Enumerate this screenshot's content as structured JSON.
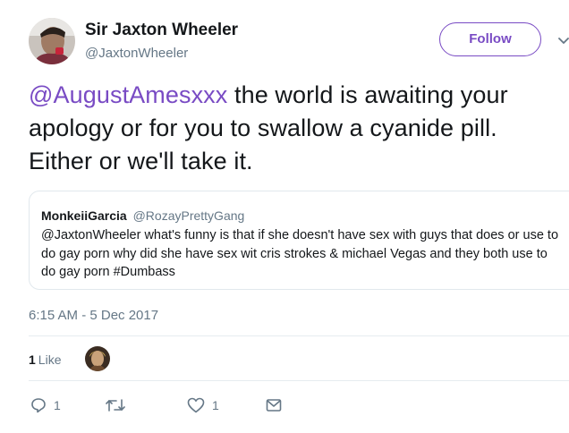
{
  "author": {
    "display_name": "Sir Jaxton Wheeler",
    "handle": "@JaxtonWheeler"
  },
  "follow_button": {
    "label": "Follow"
  },
  "tweet": {
    "mention": "@AugustAmesxxx",
    "text": " the world is awaiting your apology or for you to swallow a cyanide pill. Either or we'll take it."
  },
  "quoted_tweet": {
    "display_name": "MonkeiiGarcia",
    "handle": "@RozayPrettyGang",
    "text": "@JaxtonWheeler what's funny is that if she doesn't have sex with guys that does or use to do gay porn why did she have sex wit cris strokes & michael Vegas and they both use to do gay porn #Dumbass"
  },
  "timestamp": "6:15 AM - 5 Dec 2017",
  "likes": {
    "count": "1",
    "label": "Like"
  },
  "actions": {
    "reply_count": "1",
    "retweet_count": "",
    "like_count": "1"
  },
  "icons": {
    "reply": "reply-icon",
    "retweet": "retweet-icon",
    "like": "heart-icon",
    "dm": "envelope-icon",
    "caret": "chevron-down-icon"
  },
  "colors": {
    "accent": "#794bc4",
    "secondary_text": "#657786",
    "primary_text": "#14171a",
    "border": "#e1e8ed"
  }
}
